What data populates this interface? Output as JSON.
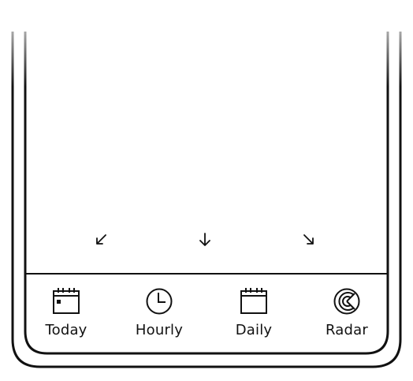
{
  "tabbar": {
    "items": [
      {
        "label": "Today",
        "icon": "calendar-today-icon"
      },
      {
        "label": "Hourly",
        "icon": "clock-icon"
      },
      {
        "label": "Daily",
        "icon": "calendar-icon"
      },
      {
        "label": "Radar",
        "icon": "radar-icon"
      }
    ]
  },
  "hints": [
    {
      "icon": "arrow-down-left-icon"
    },
    {
      "icon": "arrow-down-icon"
    },
    {
      "icon": "arrow-down-right-icon"
    }
  ],
  "colors": {
    "ink": "#111111",
    "background": "#ffffff"
  }
}
